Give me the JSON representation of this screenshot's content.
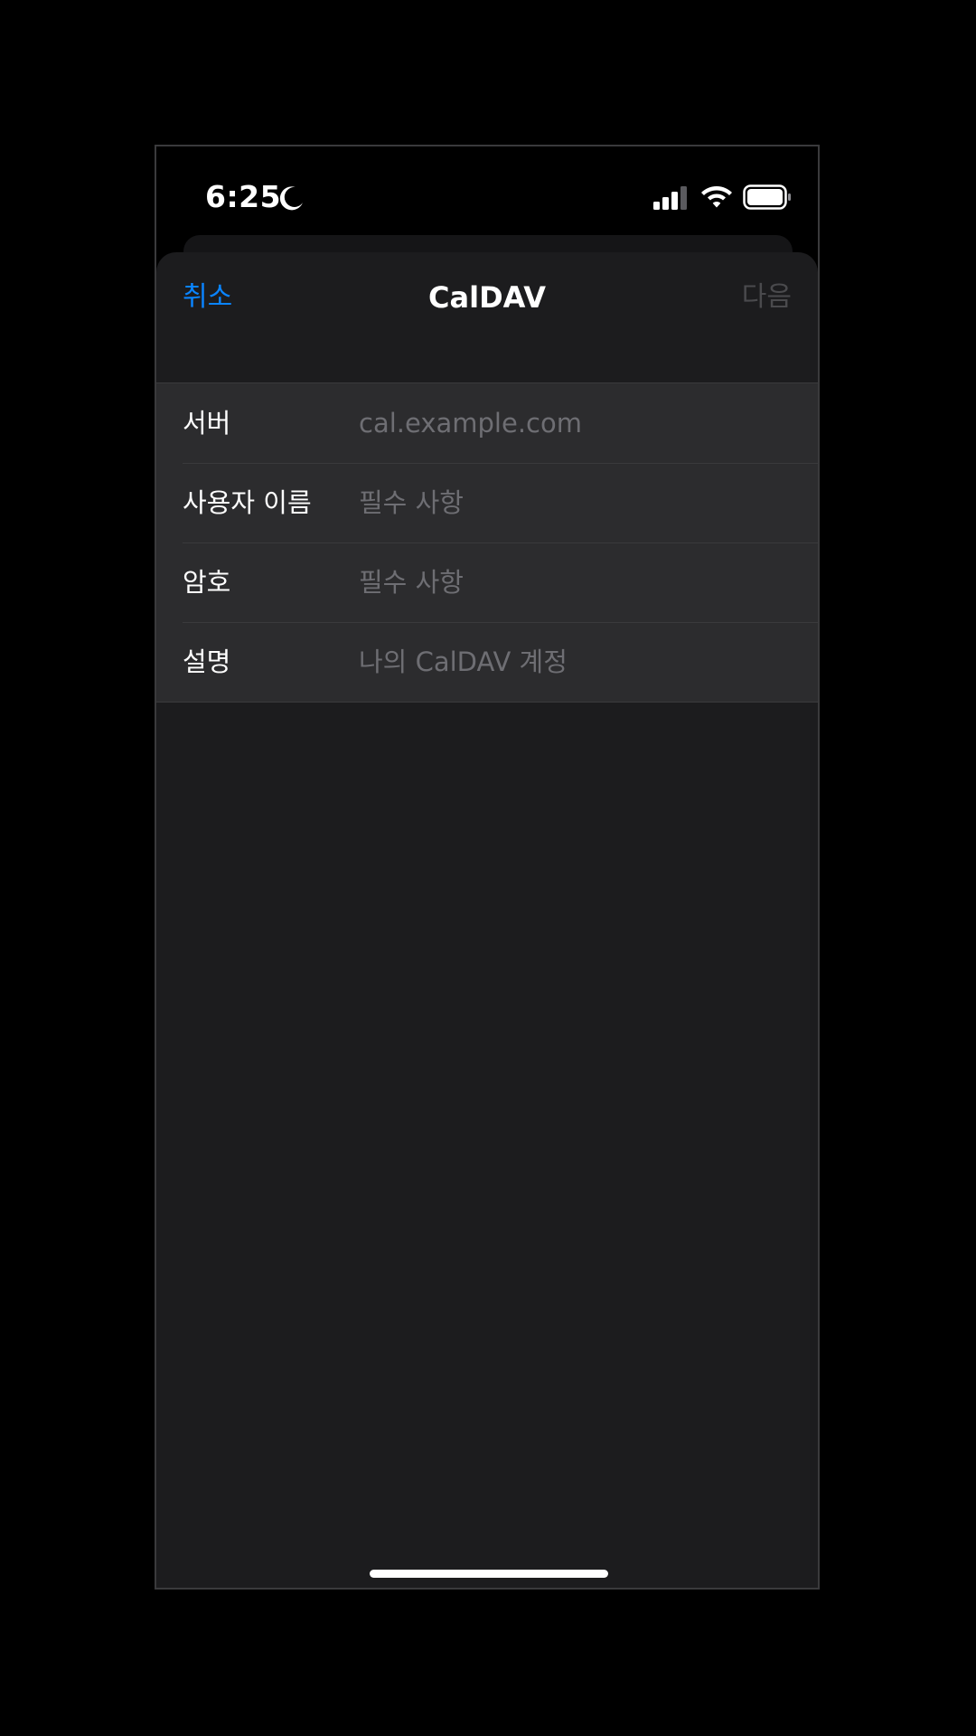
{
  "status_bar": {
    "time": "6:25",
    "focus_icon": "moon-icon",
    "signal_icon": "cellular-signal-icon",
    "wifi_icon": "wifi-icon",
    "battery_icon": "battery-icon"
  },
  "nav": {
    "cancel_label": "취소",
    "title": "CalDAV",
    "next_label": "다음"
  },
  "form": {
    "rows": [
      {
        "label": "서버",
        "placeholder": "cal.example.com",
        "value": ""
      },
      {
        "label": "사용자 이름",
        "placeholder": "필수 사항",
        "value": ""
      },
      {
        "label": "암호",
        "placeholder": "필수 사항",
        "value": ""
      },
      {
        "label": "설명",
        "placeholder": "나의 CalDAV 계정",
        "value": ""
      }
    ]
  },
  "colors": {
    "accent": "#0a84ff",
    "disabled": "#4a4a4d",
    "sheet_background": "#1c1c1e",
    "group_background": "#2c2c2e",
    "placeholder": "#6e6e73"
  }
}
